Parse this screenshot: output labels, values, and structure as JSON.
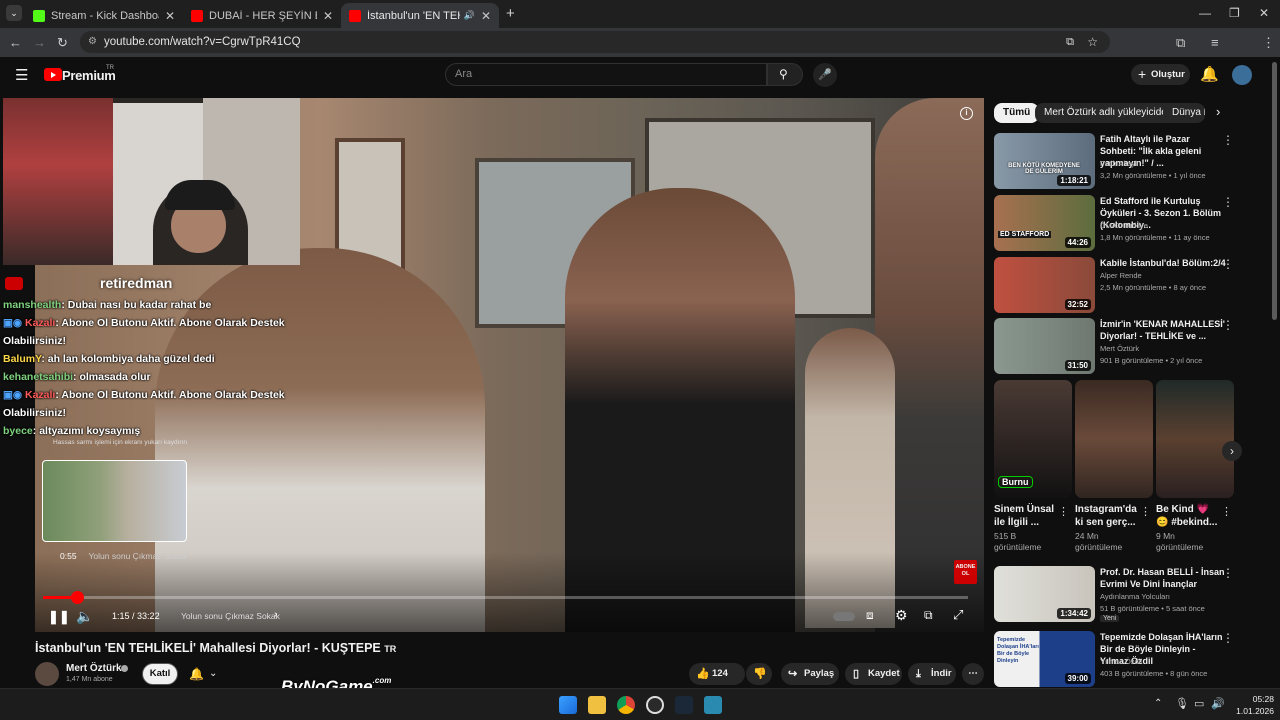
{
  "browser": {
    "tabs": [
      {
        "label": "Stream - Kick Dashboard"
      },
      {
        "label": "DUBAİ - HER ŞEYİN BİR FİYATI VAR"
      },
      {
        "label": "İstanbul'un 'EN TEHLİKELİ' Mahall"
      }
    ],
    "url": "youtube.com/watch?v=CgrwTpR41CQ"
  },
  "youtube": {
    "brand": "Premium",
    "brand_region": "TR",
    "search_placeholder": "Ara",
    "create_label": "Oluştur"
  },
  "stream_overlay": {
    "channel_text": "retiredman",
    "chat": [
      {
        "user": "manshealth",
        "msg": ": Dubai nası bu kadar rahat be"
      },
      {
        "user": "Kazalı",
        "msg": ": Abone Ol Butonu Aktif. Abone Olarak Destek Olabilirsiniz!"
      },
      {
        "user": "BalumY",
        "msg": ": ah lan kolombiya daha güzel dedi"
      },
      {
        "user": "kehanetsahibi",
        "msg": ": olmasada olur"
      },
      {
        "user": "Kazalı",
        "msg": ": Abone Ol Butonu Aktif. Abone Olarak Destek Olabilirsiniz!"
      },
      {
        "user": "byece",
        "msg": ": altyazımı koysaymış"
      }
    ],
    "tooltip": "Hassas sarmı işlemi için ekranı yukarı kaydırın"
  },
  "player": {
    "preview_time": "0:55",
    "preview_chapter": "Yolun sonu Çıkmaz Sokak",
    "time_current": "1:15",
    "time_sep": " / ",
    "time_total": "33:22",
    "chapter": "Yolun sonu Çıkmaz Sokak",
    "progress_fraction": 0.037,
    "abone_badge": "ABONE OL"
  },
  "video": {
    "title": "İstanbul'un 'EN TEHLİKELİ' Mahallesi Diyorlar! - KUŞTEPE",
    "title_suffix": "TR",
    "channel": "Mert Öztürk",
    "subscribers": "1,47 Mn abone",
    "join_label": "Katıl",
    "likes": "124 B",
    "share_label": "Paylaş",
    "save_label": "Kaydet",
    "download_label": "İndir",
    "watermark": "ByNoGame",
    "watermark_sub": ".com"
  },
  "sidebar": {
    "chips": [
      "Tümü",
      "Mert Öztürk adlı yükleyiciden",
      "Dünya H"
    ],
    "videos": [
      {
        "title": "Fatih Altaylı ile Pazar Sohbeti: \"İlk akla geleni yapmayın!\" / ...",
        "channel": "Fatih Altaylı",
        "meta": "3,2 Mn görüntüleme • 1 yıl önce",
        "duration": "1:18:21",
        "thumb_text": "BEN KÖTÜ KOMEDYENE DE GÜLERİM",
        "color": "#6b7b8c"
      },
      {
        "title": "Ed Stafford ile Kurtuluş Öyküleri - 3. Sezon 1. Bölüm (Kolombiy...",
        "channel": "DMAX Turkiye",
        "meta": "1,8 Mn görüntüleme • 11 ay önce",
        "duration": "44:26",
        "thumb_text": "ED STAFFORD",
        "color": "#5c6d3e"
      },
      {
        "title": "Kabile İstanbul'da! Bölüm:2/4",
        "channel": "Alper Rende",
        "meta": "2,5 Mn görüntüleme • 8 ay önce",
        "duration": "32:52",
        "thumb_text": "",
        "color": "#8a4a3a"
      },
      {
        "title": "İzmir'in 'KENAR MAHALLESİ' Diyorlar! - TEHLİKE ve ...",
        "channel": "Mert Öztürk",
        "meta": "901 B görüntüleme • 2 yıl önce",
        "duration": "31:50",
        "thumb_text": "",
        "color": "#6e7870"
      }
    ],
    "shorts": [
      {
        "title": "Sinem Ünsal ile İlgili ...",
        "views": "515 B görüntüleme",
        "overlay": "Burnu"
      },
      {
        "title": "Instagram'da ki sen gerç...",
        "views": "24 Mn görüntüleme",
        "overlay": ""
      },
      {
        "title": "Be Kind 💗 😊 #bekind...",
        "views": "9 Mn görüntüleme",
        "overlay": ""
      }
    ],
    "videos2": [
      {
        "title": "Prof. Dr. Hasan BELLİ - İnsan Evrimi Ve Dini İnançlar",
        "channel": "Aydınlanma Yolcuları",
        "meta": "51 B görüntüleme • 5 saat önce",
        "badge": "Yeni",
        "duration": "1:34:42",
        "color": "#d8d8d0"
      },
      {
        "title": "Tepemizde Dolaşan İHA'ların Bir de Böyle Dinleyin - Yılmaz Özdil",
        "channel": "Yılmaz Özdil",
        "meta": "403 B görüntüleme • 8 gün önce",
        "duration": "39:00",
        "thumb_text": "Tepemizde Dolaşan İHA'ları Bir de Böyle Dinleyin",
        "color": "#1d3f8a"
      }
    ]
  },
  "taskbar": {
    "time": "05:28",
    "date": "1.01.2026"
  }
}
